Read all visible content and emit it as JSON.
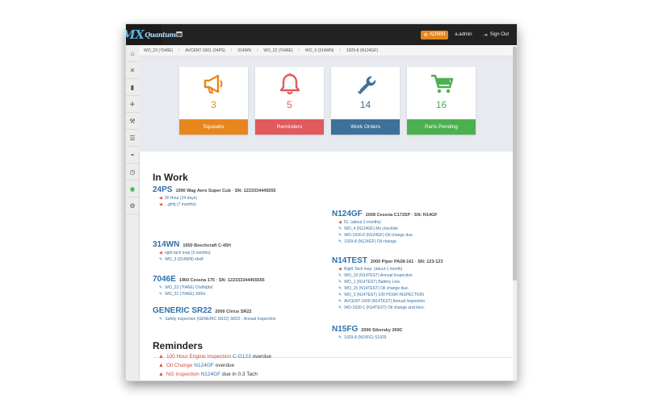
{
  "app": {
    "logo_main": "QMX",
    "logo_sub": "Quantum",
    "calendar_icon": "calendar-icon"
  },
  "topbar": {
    "admin_label": "ADMIN",
    "username": "a.admin",
    "signout_label": "Sign Out"
  },
  "sidebar": {
    "icons": [
      "home-icon",
      "close-icon",
      "book-icon",
      "plane-icon",
      "wrench-icon",
      "list-icon",
      "gauge-icon",
      "clock-icon",
      "eye-icon",
      "gear-icon"
    ]
  },
  "breadcrumb": [
    "WO_23 (7046E)",
    "AVCENT-1001 (24PS)",
    "314WN",
    "WO_22 (7046E)",
    "WO_3 (314WN)",
    "1929-8 (N124GF)"
  ],
  "tiles": [
    {
      "label": "Squawks",
      "count": "3",
      "color": "#e8861e",
      "icon": "megaphone-icon"
    },
    {
      "label": "Reminders",
      "count": "5",
      "color": "#e05a5e",
      "icon": "bell-icon"
    },
    {
      "label": "Work Orders",
      "count": "14",
      "color": "#3d7199",
      "icon": "wrench-icon"
    },
    {
      "label": "Parts Pending",
      "count": "16",
      "color": "#4cb050",
      "icon": "cart-icon"
    }
  ],
  "in_work": {
    "heading": "In Work",
    "left": [
      {
        "reg": "24PS",
        "desc": "1990 Wag Aero Super Cub · SN: 1223334445555",
        "items": [
          {
            "type": "squawk",
            "text": "30 Hour (24 days)"
          },
          {
            "type": "squawk",
            "text": "...ghhj (7 months)"
          }
        ]
      },
      {
        "reg": "314WN",
        "desc": "1950 Beechcraft C-45H",
        "items": [
          {
            "type": "squawk",
            "text": "right tach inop (3 months)"
          },
          {
            "type": "wo",
            "text": "WO_3 (314WN) sfsdf"
          }
        ]
      },
      {
        "reg": "7046E",
        "desc": "1960 Cessna 175 · SN: 122333344455555",
        "items": [
          {
            "type": "wo",
            "text": "WO_23 (7046E) Chdhdjhd"
          },
          {
            "type": "wo",
            "text": "WO_22 (7046E) 100hr"
          }
        ]
      },
      {
        "reg": "GENERIC SR22",
        "desc": "2000 Cirrus SR22",
        "items": [
          {
            "type": "wo",
            "text": "Safety inspection (GENERIC SR22) SR22 - Annual Inspection"
          }
        ]
      }
    ],
    "right": [
      {
        "reg": "N124GF",
        "desc": "2008 Cessna C172SP · SN: N14GF",
        "items": [
          {
            "type": "squawk",
            "text": "91. (about 2 months)"
          },
          {
            "type": "wo",
            "text": "WO_4 (N124GF) Mx checklist"
          },
          {
            "type": "wo",
            "text": "WO-1930-0 (N124GF) Oil change due."
          },
          {
            "type": "wo",
            "text": "1929-8 (N124GF) Oil change."
          }
        ]
      },
      {
        "reg": "N14TEST",
        "desc": "2000 Piper PA28-161 · SN: 123-123",
        "items": [
          {
            "type": "squawk",
            "text": "Right Tach inop. (about 1 month)"
          },
          {
            "type": "wo",
            "text": "WO_19 (N14TEST) Annual Inspection"
          },
          {
            "type": "wo",
            "text": "WO_1 (N14TEST) Battery Low"
          },
          {
            "type": "wo",
            "text": "WO_15 (N14TEST) Oil change due."
          },
          {
            "type": "wo",
            "text": "WO_3 (N14TEST) 100 HOUR INSPECTION"
          },
          {
            "type": "wo",
            "text": "AVCENT-1000 (N14TEST) Annual Inspection"
          },
          {
            "type": "wo",
            "text": "WO-1930-1 (N14TEST) Oil change and tires."
          }
        ]
      },
      {
        "reg": "N15FG",
        "desc": "2000 Sikorsky 269C",
        "items": [
          {
            "type": "wo",
            "text": "1929-8 (N15FG) S1929"
          }
        ]
      }
    ]
  },
  "reminders": {
    "heading": "Reminders",
    "items": [
      {
        "name": "100 Hour Engine Inspection",
        "aircraft": "C-G123",
        "status": "overdue"
      },
      {
        "name": "Oil Change",
        "aircraft": "N124GF",
        "status": "overdue"
      },
      {
        "name": "NG inspection",
        "aircraft": "N124GF",
        "status": "due in 0.3 Tach"
      }
    ]
  }
}
